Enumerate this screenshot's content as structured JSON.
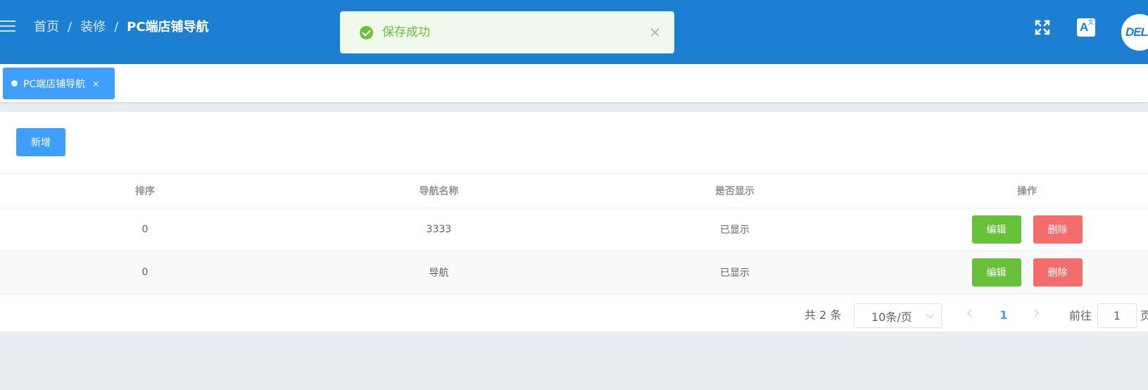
{
  "header": {
    "breadcrumb": [
      "首页",
      "装修",
      "PC端店铺导航"
    ],
    "separator": "/",
    "icons": {
      "menu": "hamburger-icon",
      "fullscreen": "fullscreen-icon",
      "language": "translate-icon"
    },
    "language_icon_letter": "A",
    "language_icon_sub": "文",
    "avatar_logo": "DELL",
    "bg_color": "#1d7fd1"
  },
  "toast": {
    "message": "保存成功",
    "type": "success",
    "color": "#67c23a"
  },
  "tabs": [
    {
      "label": "PC端店铺导航",
      "close": "×",
      "active": true
    }
  ],
  "toolbar": {
    "add_label": "新增"
  },
  "table": {
    "columns": [
      "排序",
      "导航名称",
      "是否显示",
      "操作"
    ],
    "rows": [
      {
        "sort": "0",
        "name": "3333",
        "visible": "已显示"
      },
      {
        "sort": "0",
        "name": "导航",
        "visible": "已显示"
      }
    ],
    "actions": {
      "edit": "编辑",
      "delete": "删除"
    }
  },
  "pagination": {
    "total_text": "共 2 条",
    "page_size": "10条/页",
    "current_page": "1",
    "goto_label": "前往",
    "goto_value": "1",
    "goto_suffix": "页"
  },
  "colors": {
    "primary": "#409eff",
    "success": "#67c23a",
    "danger": "#f56c6c"
  }
}
